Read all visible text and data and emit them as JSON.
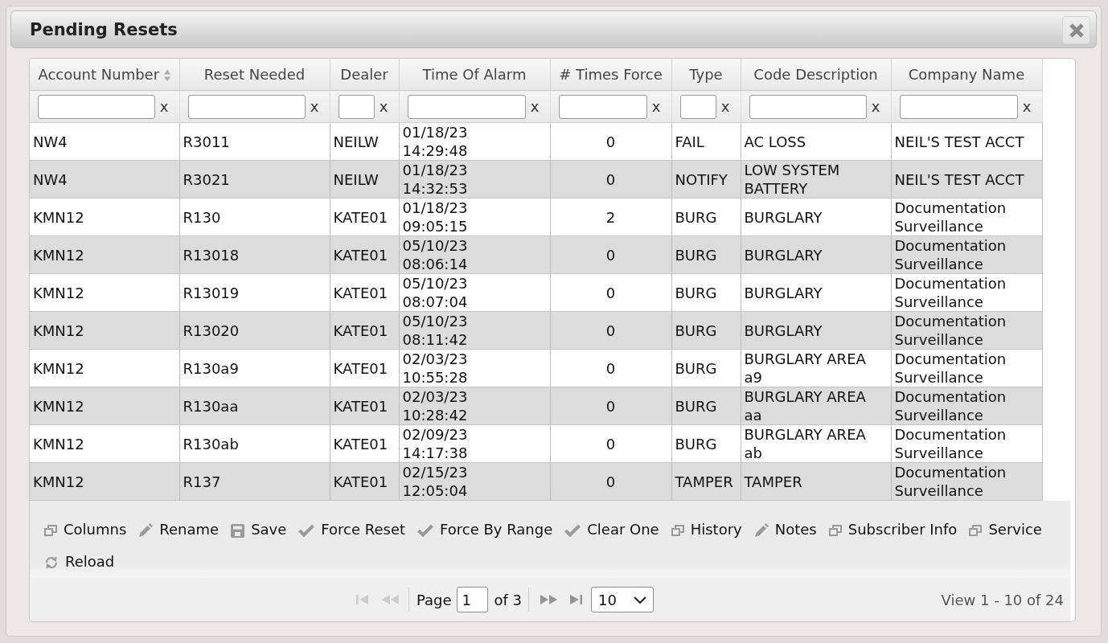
{
  "dialog": {
    "title": "Pending Resets"
  },
  "grid": {
    "columns": [
      {
        "label": "Account Number",
        "sorted": true,
        "filter_clear": "x"
      },
      {
        "label": "Reset Needed",
        "sorted": false,
        "filter_clear": "x"
      },
      {
        "label": "Dealer",
        "sorted": false,
        "filter_clear": "x"
      },
      {
        "label": "Time Of Alarm",
        "sorted": false,
        "filter_clear": "x"
      },
      {
        "label": "# Times Force",
        "sorted": false,
        "filter_clear": "x"
      },
      {
        "label": "Type",
        "sorted": false,
        "filter_clear": "x"
      },
      {
        "label": "Code Description",
        "sorted": false,
        "filter_clear": "x"
      },
      {
        "label": "Company Name",
        "sorted": false,
        "filter_clear": "x"
      }
    ],
    "rows": [
      {
        "cells": [
          "NW4",
          "R3011",
          "NEILW",
          "01/18/23 14:29:48",
          "0",
          "FAIL",
          "AC LOSS",
          "NEIL'S TEST ACCT"
        ]
      },
      {
        "cells": [
          "NW4",
          "R3021",
          "NEILW",
          "01/18/23 14:32:53",
          "0",
          "NOTIFY",
          "LOW SYSTEM BATTERY",
          "NEIL'S TEST ACCT"
        ]
      },
      {
        "cells": [
          "KMN12",
          "R130",
          "KATE01",
          "01/18/23 09:05:15",
          "2",
          "BURG",
          "BURGLARY",
          "Documentation Surveillance"
        ]
      },
      {
        "cells": [
          "KMN12",
          "R13018",
          "KATE01",
          "05/10/23 08:06:14",
          "0",
          "BURG",
          "BURGLARY",
          "Documentation Surveillance"
        ]
      },
      {
        "cells": [
          "KMN12",
          "R13019",
          "KATE01",
          "05/10/23 08:07:04",
          "0",
          "BURG",
          "BURGLARY",
          "Documentation Surveillance"
        ]
      },
      {
        "cells": [
          "KMN12",
          "R13020",
          "KATE01",
          "05/10/23 08:11:42",
          "0",
          "BURG",
          "BURGLARY",
          "Documentation Surveillance"
        ]
      },
      {
        "cells": [
          "KMN12",
          "R130a9",
          "KATE01",
          "02/03/23 10:55:28",
          "0",
          "BURG",
          "BURGLARY AREA a9",
          "Documentation Surveillance"
        ]
      },
      {
        "cells": [
          "KMN12",
          "R130aa",
          "KATE01",
          "02/03/23 10:28:42",
          "0",
          "BURG",
          "BURGLARY AREA aa",
          "Documentation Surveillance"
        ]
      },
      {
        "cells": [
          "KMN12",
          "R130ab",
          "KATE01",
          "02/09/23 14:17:38",
          "0",
          "BURG",
          "BURGLARY AREA ab",
          "Documentation Surveillance"
        ]
      },
      {
        "cells": [
          "KMN12",
          "R137",
          "KATE01",
          "02/15/23 12:05:04",
          "0",
          "TAMPER",
          "TAMPER",
          "Documentation Surveillance"
        ]
      }
    ]
  },
  "toolbar": [
    {
      "label": "Columns",
      "kind": "window"
    },
    {
      "label": "Rename",
      "kind": "pencil"
    },
    {
      "label": "Save",
      "kind": "disk"
    },
    {
      "label": "Force Reset",
      "kind": "check"
    },
    {
      "label": "Force By Range",
      "kind": "check"
    },
    {
      "label": "Clear One",
      "kind": "check"
    },
    {
      "label": "History",
      "kind": "window"
    },
    {
      "label": "Notes",
      "kind": "pencil"
    },
    {
      "label": "Subscriber Info",
      "kind": "window"
    },
    {
      "label": "Service",
      "kind": "window"
    },
    {
      "label": "Reload",
      "kind": "refresh"
    }
  ],
  "pager": {
    "nav": [
      {
        "kind": "first",
        "disabled": true
      },
      {
        "kind": "previous",
        "disabled": true
      },
      {
        "kind": "next",
        "disabled": false
      },
      {
        "kind": "last",
        "disabled": false
      }
    ],
    "page_label": "Page",
    "page": "1",
    "page_count": "of 3",
    "page_size": "10",
    "summary": "View 1 - 10 of 24"
  }
}
